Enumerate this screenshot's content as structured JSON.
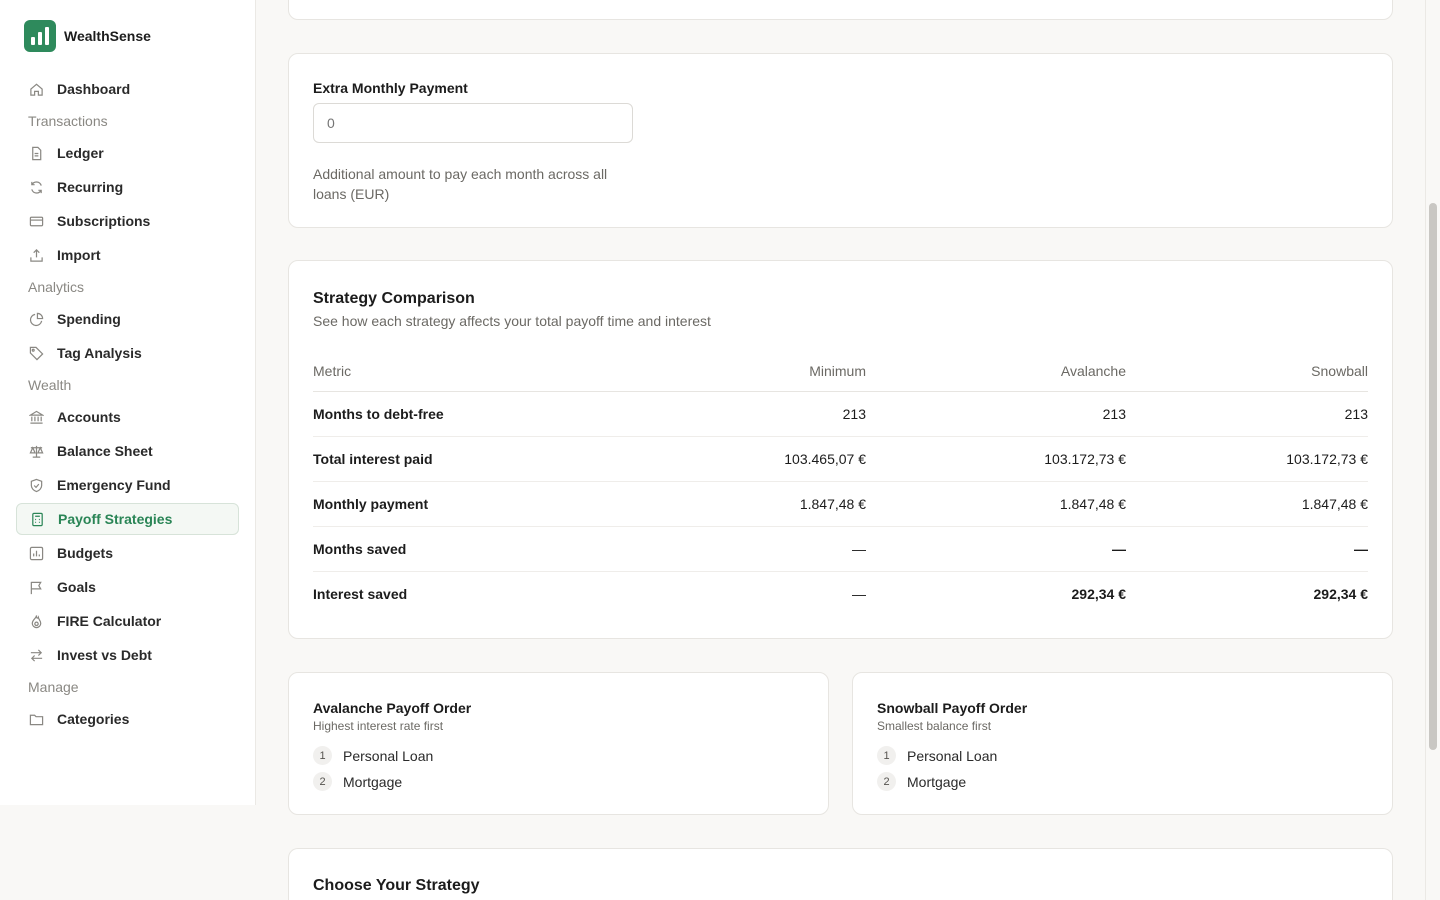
{
  "brand": {
    "name": "WealthSense",
    "accent": "#2e8a5c"
  },
  "sidebar": {
    "items": [
      {
        "label": "Dashboard",
        "icon": "home-icon"
      },
      {
        "label": "Ledger",
        "icon": "file-icon"
      },
      {
        "label": "Recurring",
        "icon": "refresh-icon"
      },
      {
        "label": "Subscriptions",
        "icon": "credit-card-icon"
      },
      {
        "label": "Import",
        "icon": "upload-icon"
      },
      {
        "label": "Spending",
        "icon": "pie-chart-icon"
      },
      {
        "label": "Tag Analysis",
        "icon": "tag-icon"
      },
      {
        "label": "Accounts",
        "icon": "bank-icon"
      },
      {
        "label": "Balance Sheet",
        "icon": "scale-icon"
      },
      {
        "label": "Emergency Fund",
        "icon": "shield-icon"
      },
      {
        "label": "Payoff Strategies",
        "icon": "calculator-icon",
        "active": true
      },
      {
        "label": "Budgets",
        "icon": "bar-chart-icon"
      },
      {
        "label": "Goals",
        "icon": "flag-icon"
      },
      {
        "label": "FIRE Calculator",
        "icon": "flame-icon"
      },
      {
        "label": "Invest vs Debt",
        "icon": "arrows-icon"
      },
      {
        "label": "Categories",
        "icon": "folder-icon"
      }
    ],
    "sections": [
      "Transactions",
      "Analytics",
      "Wealth",
      "Manage"
    ]
  },
  "extra_payment": {
    "label": "Extra Monthly Payment",
    "placeholder": "0",
    "helper": "Additional amount to pay each month across all loans (EUR)"
  },
  "comparison": {
    "title": "Strategy Comparison",
    "subtitle": "See how each strategy affects your total payoff time and interest",
    "headers": [
      "Metric",
      "Minimum",
      "Avalanche",
      "Snowball"
    ],
    "rows": [
      {
        "metric": "Months to debt-free",
        "minimum": "213",
        "avalanche": "213",
        "snowball": "213"
      },
      {
        "metric": "Total interest paid",
        "minimum": "103.465,07 €",
        "avalanche": "103.172,73 €",
        "snowball": "103.172,73 €"
      },
      {
        "metric": "Monthly payment",
        "minimum": "1.847,48 €",
        "avalanche": "1.847,48 €",
        "snowball": "1.847,48 €"
      },
      {
        "metric": "Months saved",
        "minimum": "—",
        "avalanche": "—",
        "snowball": "—"
      },
      {
        "metric": "Interest saved",
        "minimum": "—",
        "avalanche": "292,34 €",
        "snowball": "292,34 €"
      }
    ]
  },
  "avalanche_order": {
    "title": "Avalanche Payoff Order",
    "subtitle": "Highest interest rate first",
    "items": [
      {
        "rank": "1",
        "name": "Personal Loan"
      },
      {
        "rank": "2",
        "name": "Mortgage"
      }
    ]
  },
  "snowball_order": {
    "title": "Snowball Payoff Order",
    "subtitle": "Smallest balance first",
    "items": [
      {
        "rank": "1",
        "name": "Personal Loan"
      },
      {
        "rank": "2",
        "name": "Mortgage"
      }
    ]
  },
  "choose": {
    "title": "Choose Your Strategy"
  }
}
